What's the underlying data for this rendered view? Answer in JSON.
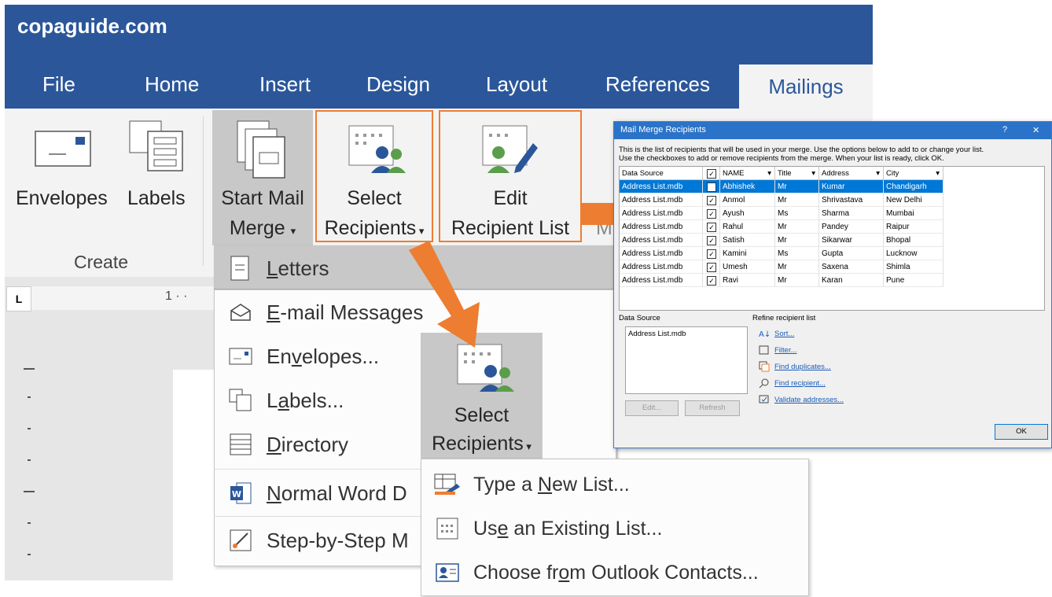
{
  "site": "copaguide.com",
  "tabs": [
    "File",
    "Home",
    "Insert",
    "Design",
    "Layout",
    "References",
    "Mailings"
  ],
  "ribbon": {
    "envelopes": "Envelopes",
    "labels": "Labels",
    "create": "Create",
    "start_mail_merge_1": "Start Mail",
    "start_mail_merge_2": "Merge",
    "select_recipients_1": "Select",
    "select_recipients_2": "Recipients",
    "edit_recipient_1": "Edit",
    "edit_recipient_2": "Recipient List",
    "cut_letter": "M"
  },
  "ruler_marks": "1 · ·",
  "ruler_corner": "L",
  "start_merge_menu": [
    {
      "icon": "letter-icon",
      "label": "Letters",
      "mnemonic": "L",
      "rest": "etters"
    },
    {
      "icon": "email-icon",
      "label": "E-mail Messages",
      "mnemonic": "E",
      "rest": "-mail Messages"
    },
    {
      "icon": "envelope-icon",
      "label": "Envelopes...",
      "pre": "En",
      "mnemonic": "v",
      "rest": "elopes..."
    },
    {
      "icon": "labels-icon",
      "label": "Labels...",
      "pre": "L",
      "mnemonic": "a",
      "rest": "bels..."
    },
    {
      "icon": "directory-icon",
      "label": "Directory",
      "mnemonic": "D",
      "rest": "irectory"
    },
    {
      "icon": "word-doc-icon",
      "label": "Normal Word D",
      "mnemonic": "N",
      "rest": "ormal Word D"
    },
    {
      "icon": "wizard-icon",
      "label": "Step-by-Step M",
      "mnemonic": "",
      "rest": "Step-by-Step M"
    }
  ],
  "select_panel": {
    "line1": "Select",
    "line2": "Recipients"
  },
  "select_menu": [
    {
      "icon": "new-list-icon",
      "pre": "Type a ",
      "mnemonic": "N",
      "rest": "ew List..."
    },
    {
      "icon": "existing-list-icon",
      "pre": "Us",
      "mnemonic": "e",
      "rest": " an Existing List..."
    },
    {
      "icon": "outlook-contacts-icon",
      "pre": "Choose fr",
      "mnemonic": "o",
      "rest": "m Outlook Contacts..."
    }
  ],
  "dialog": {
    "title": "Mail Merge Recipients",
    "help": "?",
    "close": "✕",
    "intro_1": "This is the list of recipients that will be used in your merge.  Use the options below to add to or change your list.",
    "intro_2": "Use the checkboxes to add or remove recipients from the merge.  When your list is ready, click OK.",
    "headers": [
      "Data Source",
      "NAME",
      "Title",
      "Address",
      "City"
    ],
    "rows": [
      {
        "source": "Address List.mdb",
        "checked": true,
        "name": "Abhishek",
        "title": "Mr",
        "address": "Kumar",
        "city": "Chandigarh"
      },
      {
        "source": "Address List.mdb",
        "checked": true,
        "name": "Anmol",
        "title": "Mr",
        "address": "Shrivastava",
        "city": "New Delhi"
      },
      {
        "source": "Address List.mdb",
        "checked": true,
        "name": "Ayush",
        "title": "Ms",
        "address": "Sharma",
        "city": "Mumbai"
      },
      {
        "source": "Address List.mdb",
        "checked": true,
        "name": "Rahul",
        "title": "Mr",
        "address": "Pandey",
        "city": "Raipur"
      },
      {
        "source": "Address List.mdb",
        "checked": true,
        "name": "Satish",
        "title": "Mr",
        "address": "Sikarwar",
        "city": "Bhopal"
      },
      {
        "source": "Address List.mdb",
        "checked": true,
        "name": "Kamini",
        "title": "Ms",
        "address": "Gupta",
        "city": "Lucknow"
      },
      {
        "source": "Address List.mdb",
        "checked": true,
        "name": "Umesh",
        "title": "Mr",
        "address": "Saxena",
        "city": "Shimla"
      },
      {
        "source": "Address List.mdb",
        "checked": true,
        "name": "Ravi",
        "title": "Mr",
        "address": "Karan",
        "city": "Pune"
      }
    ],
    "data_source_label": "Data Source",
    "data_source_item": "Address List.mdb",
    "refine_label": "Refine recipient list",
    "links": [
      "Sort...",
      "Filter...",
      "Find duplicates...",
      "Find recipient...",
      "Validate addresses..."
    ],
    "edit_btn": "Edit...",
    "refresh_btn": "Refresh",
    "ok_btn": "OK"
  },
  "colors": {
    "word_blue": "#2b579a",
    "accent_orange": "#ed7d31"
  }
}
